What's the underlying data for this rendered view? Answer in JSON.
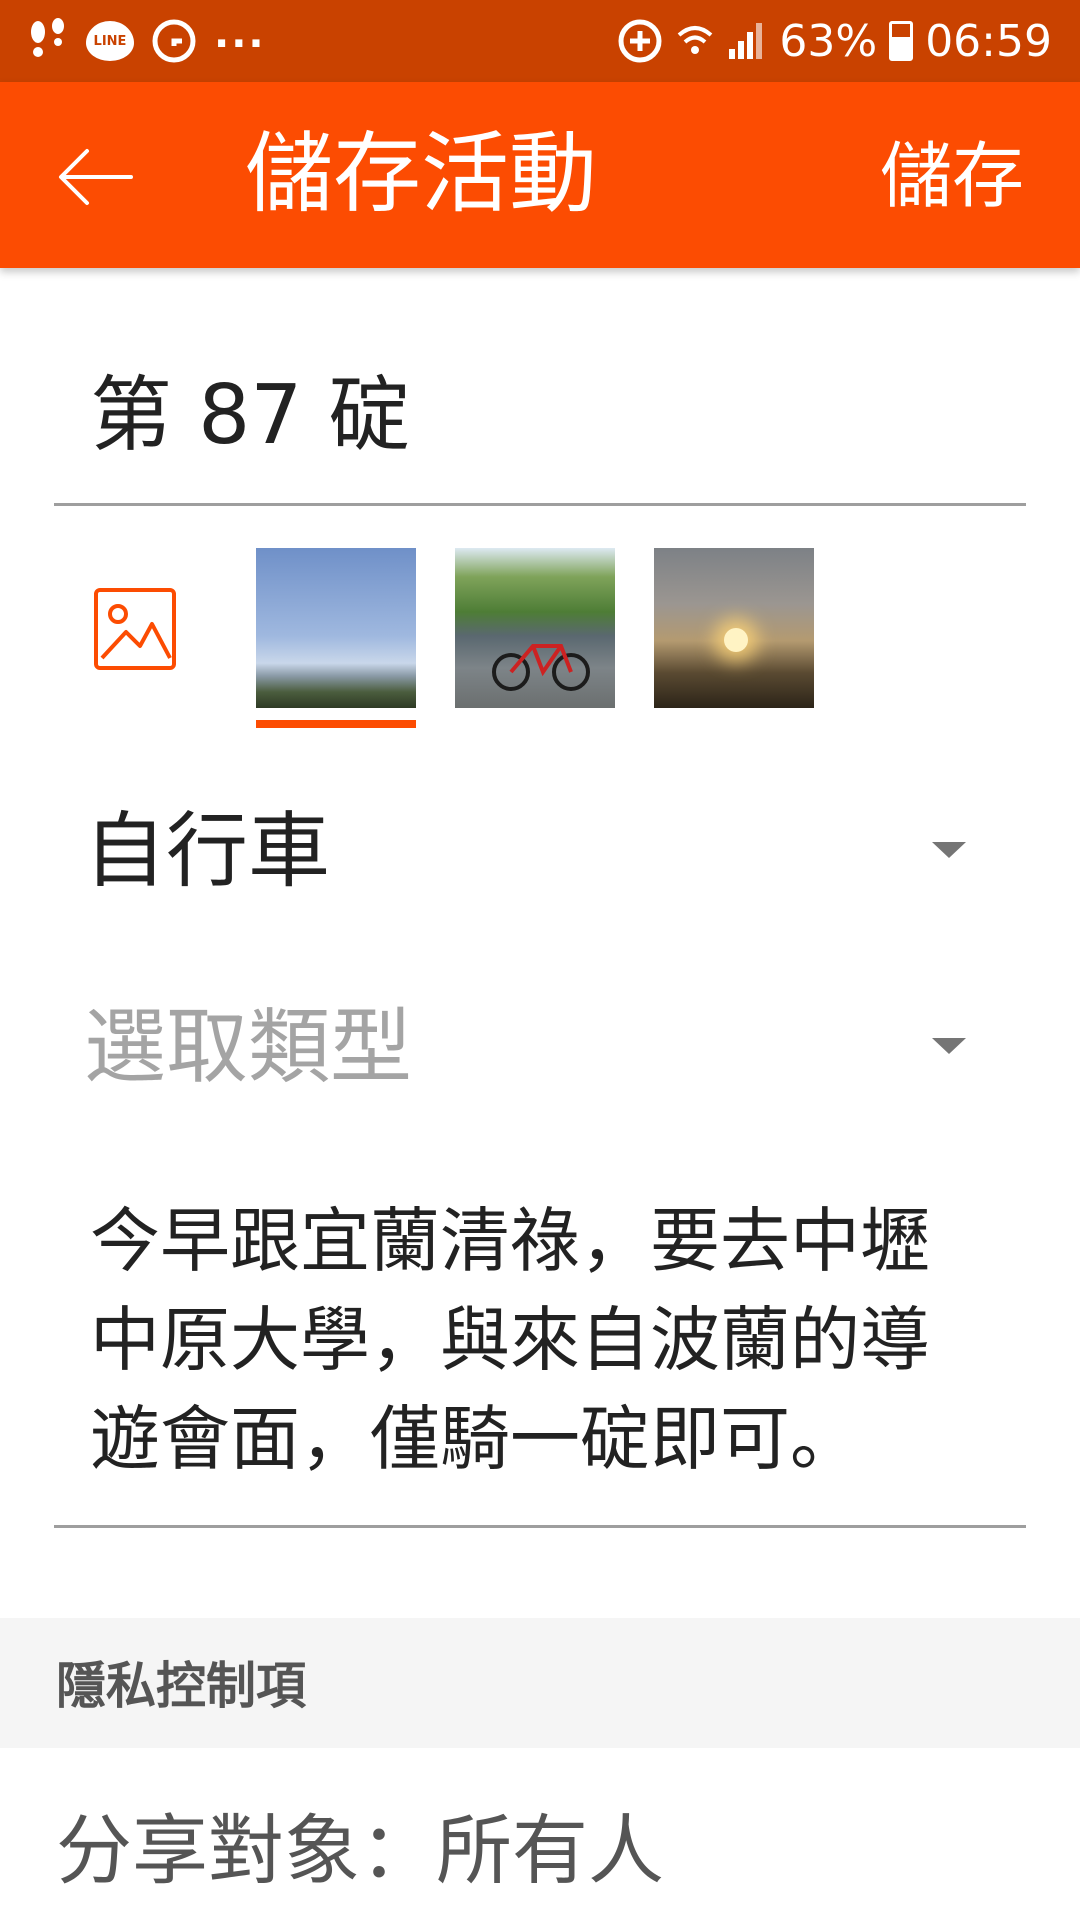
{
  "status_bar": {
    "left_icons": [
      "footprints-icon",
      "line-app-icon",
      "grammarly-icon",
      "more-dots-icon"
    ],
    "line_label": "LINE",
    "overflow": "...",
    "battery_percent": "63%",
    "time": "06:59"
  },
  "app_bar": {
    "title": "儲存活動",
    "save_label": "儲存",
    "background": "#fc4c02"
  },
  "form": {
    "title_value": "第 87 碇",
    "photos": [
      {
        "name": "photo-sky",
        "selected": true
      },
      {
        "name": "photo-bike-sign",
        "selected": false
      },
      {
        "name": "photo-sunset",
        "selected": false
      }
    ],
    "sport_value": "自行車",
    "type_placeholder": "選取類型",
    "description": "今早跟宜蘭清祿，要去中壢中原大學，與來自波蘭的導遊會面，僅騎一碇即可。"
  },
  "privacy": {
    "header": "隱私控制項",
    "share_label": "分享對象：所有人"
  }
}
